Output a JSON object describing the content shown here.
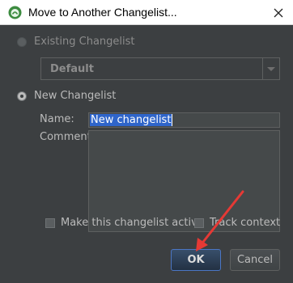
{
  "window": {
    "title": "Move to Another Changelist...",
    "app_icon": "android-studio-icon",
    "close_icon": "close-icon"
  },
  "existing_changelist": {
    "label": "Existing Changelist",
    "selected": false,
    "combo_value": "Default"
  },
  "new_changelist": {
    "label": "New Changelist",
    "selected": true,
    "name_label": "Name:",
    "name_value": "New changelist",
    "comment_label": "Comment:",
    "comment_value": ""
  },
  "options": {
    "make_active_label": "Make this changelist active",
    "make_active_checked": false,
    "track_context_label": "Track context",
    "track_context_checked": false
  },
  "buttons": {
    "ok_label": "OK",
    "cancel_label": "Cancel"
  },
  "annotation": {
    "arrow_color": "#e53935",
    "points_to": "ok-button"
  },
  "colors": {
    "background": "#3c3f41",
    "text": "#bbbbbb",
    "selection": "#2f65ca",
    "default_button_border": "#4b76c4"
  }
}
